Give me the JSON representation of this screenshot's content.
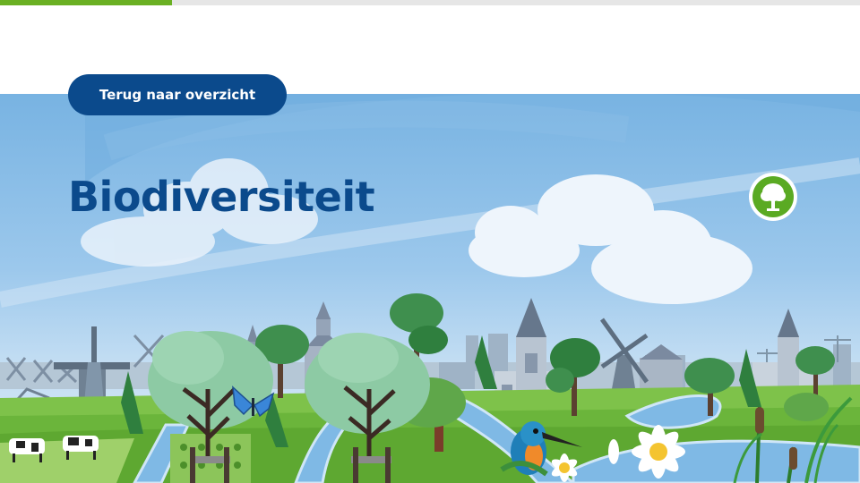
{
  "progress": {
    "value": 0.2,
    "color": "#6ab023"
  },
  "navigation": {
    "back_label": "Terug naar overzicht"
  },
  "page": {
    "title": "Biodiversiteit"
  },
  "badge": {
    "icon": "tree-icon"
  },
  "colors": {
    "brand_blue": "#0b4a8c",
    "accent_green": "#5aaa23",
    "sky": "#9cc8ec"
  },
  "illustration": {
    "subjects": [
      "windmill-icon",
      "church-icon",
      "tree-icon",
      "cow-icon",
      "butterfly-icon",
      "kingfisher-icon",
      "daisy-icon",
      "reed-icon",
      "crane-icon",
      "greenhouse-icon"
    ]
  }
}
